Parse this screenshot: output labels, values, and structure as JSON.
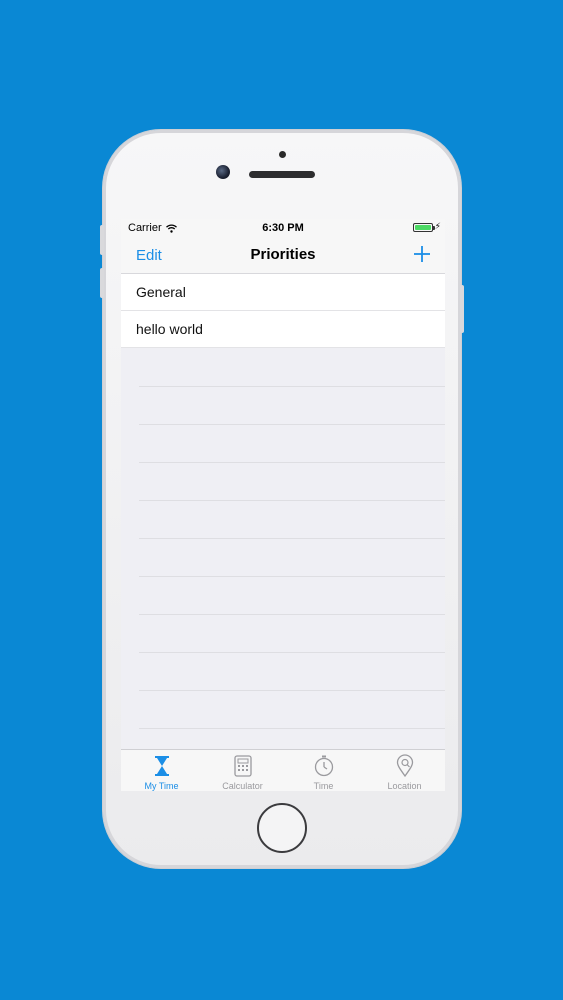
{
  "status_bar": {
    "carrier": "Carrier",
    "time": "6:30 PM",
    "battery_level": 1.0,
    "wifi_icon": "wifi-icon",
    "charging_icon": "bolt-icon"
  },
  "nav": {
    "edit_label": "Edit",
    "title": "Priorities",
    "add_icon": "plus-icon"
  },
  "list": {
    "items": [
      {
        "label": "General"
      },
      {
        "label": "hello world"
      }
    ]
  },
  "tabs": [
    {
      "label": "My Time",
      "icon": "hourglass-icon",
      "active": true
    },
    {
      "label": "Calculator",
      "icon": "calculator-icon",
      "active": false
    },
    {
      "label": "Time",
      "icon": "stopwatch-icon",
      "active": false
    },
    {
      "label": "Location",
      "icon": "location-pin-icon",
      "active": false
    }
  ],
  "colors": {
    "background": "#0a88d4",
    "accent": "#1b8ee6",
    "battery": "#4cd964"
  }
}
